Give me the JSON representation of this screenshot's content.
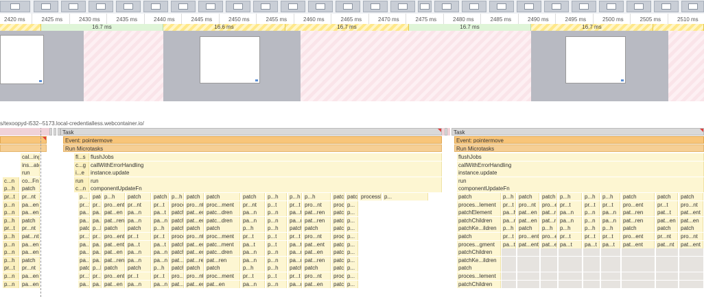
{
  "ruler": {
    "ticks": [
      "2420 ms",
      "2425 ms",
      "2430 ms",
      "2435 ms",
      "2440 ms",
      "2445 ms",
      "2450 ms",
      "2455 ms",
      "2460 ms",
      "2465 ms",
      "2470 ms",
      "2475 ms",
      "2480 ms",
      "2485 ms",
      "2490 ms",
      "2495 ms",
      "2500 ms",
      "2505 ms",
      "2510 ms"
    ]
  },
  "frames": {
    "labels": [
      "16.7 ms",
      "16.6 ms",
      "16.7 ms",
      "16.7 ms",
      "16.7 ms"
    ]
  },
  "url": "s/texoopyd-i532--5173.local-credentialless.webcontainer.io/",
  "tasks": {
    "task_left": "Task",
    "task_right": "Task",
    "event_left": "Event: pointermove",
    "event_right": "Event: pointermove",
    "micro_left": "Run Microtasks",
    "micro_right": "Run Microtasks"
  },
  "colors": {
    "task": "#d9d9d9",
    "event": "#f8c57a",
    "microtask": "#f6cf95",
    "call": "#fdf6d2",
    "dropped_frame": "#ffe889",
    "frame": "#dff5d8"
  },
  "flame_left_col": [
    [
      "",
      "",
      ""
    ],
    [
      "",
      "",
      ""
    ],
    [
      "",
      "",
      ""
    ],
    [
      "cal...ing",
      "",
      ""
    ],
    [
      "ins...ate",
      "",
      ""
    ],
    [
      "run",
      "",
      ""
    ],
    [
      "co...Fn",
      "c...n",
      ""
    ],
    [
      "patch",
      "p...h",
      ""
    ],
    [
      "pr...nt",
      "pr...t",
      ""
    ],
    [
      "pa...en",
      "p...n",
      ""
    ],
    [
      "pa...en",
      "p...n",
      ""
    ],
    [
      "patch",
      "p...h",
      ""
    ],
    [
      "pr...nt",
      "pr...t",
      ""
    ],
    [
      "pat...nt",
      "p...h",
      ""
    ],
    [
      "pa...en",
      "p...n",
      ""
    ],
    [
      "pa...en",
      "p...n",
      ""
    ],
    [
      "patch",
      "p...h",
      ""
    ],
    [
      "pr...nt",
      "pr...t",
      ""
    ],
    [
      "pa...en",
      "p...n",
      ""
    ],
    [
      "pa...en",
      "p...n",
      ""
    ]
  ],
  "flame_mid": {
    "row1": [
      "fl...s",
      "flushJobs"
    ],
    "row2": [
      "c...g",
      "callWithErrorHandling"
    ],
    "row3": [
      "i...e",
      "instance.update"
    ],
    "row4": [
      "run",
      "run"
    ],
    "row5": [
      "c...n",
      "componentUpdateFn"
    ]
  },
  "flame_grid": [
    [
      "p...",
      "patch",
      "p...h",
      "patch",
      "patch",
      "p...h",
      "patch",
      "patch",
      "patch",
      "p...h",
      "p...h",
      "p...h",
      "patch",
      "patch",
      "processFragment",
      "p..."
    ],
    [
      "pr...t",
      "pr...t",
      "pro...ent",
      "pr...nt",
      "pr...t",
      "proce...gment",
      "pro...nt",
      "proc...ment",
      "pr...nt",
      "p...t",
      "pr...t",
      "pro...nt",
      "processFragment",
      "p..."
    ],
    [
      "pa...t",
      "pa...t",
      "pat...en",
      "pa...n",
      "pa...t",
      "patchChildren",
      "pat...en",
      "patc...dren",
      "pa...n",
      "p...n",
      "pa...t",
      "pat...ren",
      "patchChildren",
      "p..."
    ],
    [
      "pa...n",
      "pa...n",
      "pat...ren",
      "pa...n",
      "pa...n",
      "patchK...ldren",
      "pat...en",
      "patc...dren",
      "pa...n",
      "p...n",
      "pa...n",
      "pat...ren",
      "patchKe...hildren",
      "p..."
    ],
    [
      "patch",
      "p...h",
      "patch",
      "patch",
      "p...h",
      "patch",
      "patch",
      "patch",
      "p...h",
      "p...h",
      "patch",
      "patch",
      "patch",
      "p..."
    ],
    [
      "pr...t",
      "pr...t",
      "pro...ent",
      "pr...t",
      "pr...t",
      "proce...ement",
      "pro...nt",
      "proc...ment",
      "pr...t",
      "p...t",
      "pr...t",
      "pro...nt",
      "processElement",
      "p..."
    ],
    [
      "pa...t",
      "pa...t",
      "pat...ent",
      "pa...t",
      "pa...t",
      "patchElement",
      "pat...ent",
      "patc...ment",
      "pa...t",
      "p...t",
      "pa...t",
      "pat...ent",
      "patchElement",
      "p..."
    ],
    [
      "pa...n",
      "pa...n",
      "pat...en",
      "pa...n",
      "pa...n",
      "patchChildren",
      "pat...en",
      "patc...dren",
      "pa...n",
      "p...n",
      "pa...n",
      "pat...en",
      "patchChildren",
      "p..."
    ],
    [
      "pa...n",
      "pa...n",
      "pat...ren",
      "pa...n",
      "pa...n",
      "pat...ren",
      "pat...ren",
      "pat...ren",
      "pa...n",
      "p...n",
      "pa...n",
      "pat...ren",
      "patchKe...hildren",
      "p..."
    ],
    [
      "patch",
      "p...h",
      "patch",
      "patch",
      "p...h",
      "patch",
      "patch",
      "patch",
      "p...h",
      "p...h",
      "patch",
      "patch",
      "patch",
      "p..."
    ],
    [
      "pr...t",
      "pr...t",
      "pro...ent",
      "pr...t",
      "pr...t",
      "pro...ent",
      "pro...nt",
      "proc...ment",
      "pr...t",
      "p...t",
      "pr...t",
      "pro...nt",
      "processElement",
      "p..."
    ],
    [
      "pa...n",
      "pa...n",
      "pat...en",
      "pa...n",
      "pa...n",
      "pat...en",
      "pat...en",
      "pat...en",
      "pa...n",
      "p...n",
      "pa...n",
      "pat...en",
      "patchKe...hildren",
      "p..."
    ]
  ],
  "flame_right_first": {
    "row1": "flushJobs",
    "row2": "callWithErrorHandling",
    "row3": "instance.update",
    "row4": "run",
    "row5": "componentUpdateFn",
    "rows": [
      "patch",
      "proces...lement",
      "patchElement",
      "patchChildren",
      "patchKe...ildren",
      "patch",
      "proces...gment",
      "patchChildren",
      "patchKe...ildren",
      "patch",
      "proces...lement",
      "patchChildren"
    ]
  },
  "flame_right_grid": [
    [
      "p...h",
      "patch",
      "patch",
      "p...h",
      "p...h",
      "p...h",
      "patch",
      "patch",
      "patch"
    ],
    [
      "pr...t",
      "pro...nt",
      "pro...ent",
      "pr...t",
      "pr...t",
      "pr...t",
      "pro...ent",
      "pr...t",
      "pro...nt"
    ],
    [
      "pa...h",
      "pat...en",
      "pat...ren",
      "pa...n",
      "p...n",
      "pa...n",
      "pat...ren",
      "pat...t",
      "pat...ent"
    ],
    [
      "pa...n",
      "pat...en",
      "pat...ren",
      "pa...n",
      "p...n",
      "pa...n",
      "pat...ren",
      "pat...en",
      "pat...en"
    ],
    [
      "p...h",
      "patch",
      "p...h",
      "p...h",
      "p...h",
      "p...h",
      "patch",
      "patch",
      "patch"
    ],
    [
      "pr...t",
      "pro...ent",
      "pro...ent",
      "pr...t",
      "pr...t",
      "pr...t",
      "pro...ent",
      "pr...nt",
      "pro...nt"
    ],
    [
      "pa...t",
      "pat...ent",
      "pat...ent",
      "pa...t",
      "pa...t",
      "pa...t",
      "pat...ent",
      "pat...nt",
      "pat...ent"
    ]
  ]
}
